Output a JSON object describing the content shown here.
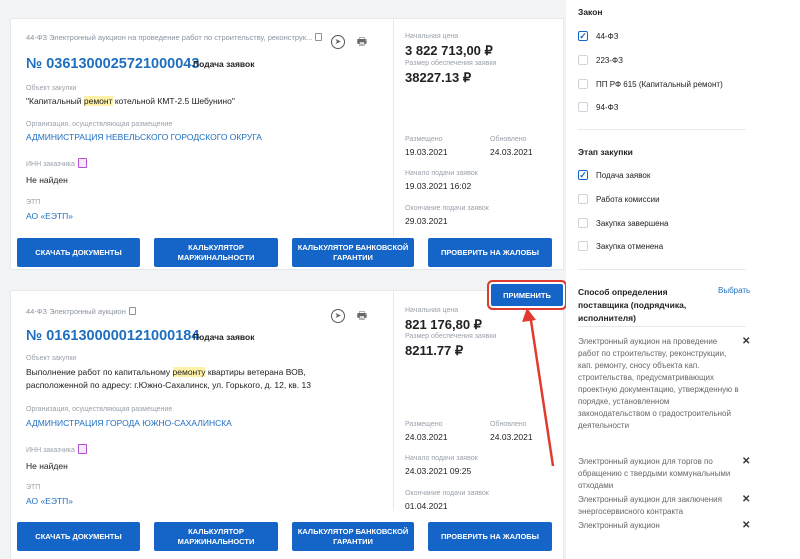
{
  "cards": [
    {
      "tag": "44-ФЗ Электронный аукцион на проведение работ по строительству, реконструк...",
      "number": "№ 0361300025721000043",
      "status": "Подача заявок",
      "object_label": "Объект закупки",
      "object_pre": "\"Капитальный ",
      "object_hl": "ремонт",
      "object_post": " котельной КМТ-2.5 Шебунино\"",
      "org_label": "Организация, осуществляющая размещение",
      "org": "АДМИНИСТРАЦИЯ НЕВЕЛЬСКОГО ГОРОДСКОГО ОКРУГА",
      "inn_label": "ИНН заказчика",
      "inn": "Не найден",
      "etp_label": "ЭТП",
      "etp": "АО «ЕЭТП»",
      "start_price_label": "Начальная цена",
      "start_price": "3 822 713,00 ₽",
      "security_label": "Размер обеспечения заявки",
      "security": "38227.13 ₽",
      "placed_label": "Размещено",
      "placed": "19.03.2021",
      "updated_label": "Обновлено",
      "updated": "24.03.2021",
      "start_label": "Начало подачи заявок",
      "start": "19.03.2021 16:02",
      "end_label": "Окончание подачи заявок",
      "end": "29.03.2021"
    },
    {
      "tag": "44-ФЗ Электронный аукцион",
      "number": "№ 0161300000121000184",
      "status": "Подача заявок",
      "object_label": "Объект закупки",
      "object_pre": "Выполнение работ по капитальному ",
      "object_hl": "ремонту",
      "object_post": " квартиры ветерана ВОВ, расположенной по адресу: г.Южно-Сахалинск, ул. Горького, д. 12, кв. 13",
      "org_label": "Организация, осуществляющая размещение",
      "org": "АДМИНИСТРАЦИЯ ГОРОДА ЮЖНО-САХАЛИНСКА",
      "inn_label": "ИНН заказчика",
      "inn": "Не найден",
      "etp_label": "ЭТП",
      "etp": "АО «ЕЭТП»",
      "start_price_label": "Начальная цена",
      "start_price": "821 176,80 ₽",
      "security_label": "Размер обеспечения заявки",
      "security": "8211.77 ₽",
      "placed_label": "Размещено",
      "placed": "24.03.2021",
      "updated_label": "Обновлено",
      "updated": "24.03.2021",
      "start_label": "Начало подачи заявок",
      "start": "24.03.2021 09:25",
      "end_label": "Окончание подачи заявок",
      "end": "01.04.2021"
    }
  ],
  "buttons": {
    "download": "СКАЧАТЬ ДОКУМЕНТЫ",
    "margin_calc_1": "КАЛЬКУЛЯТОР",
    "margin_calc_2": "МАРЖИНАЛЬНОСТИ",
    "bank_calc_1": "КАЛЬКУЛЯТОР БАНКОВСКОЙ",
    "bank_calc_2": "ГАРАНТИИ",
    "complaints": "ПРОВЕРИТЬ НА ЖАЛОБЫ",
    "apply": "ПРИМЕНИТЬ"
  },
  "icons": {
    "card_left": "compass-icon",
    "card_right": "printer-icon",
    "copy": "copy-icon",
    "inn": "document-icon",
    "close": "close-icon"
  },
  "sidebar": {
    "law_title": "Закон",
    "laws": [
      {
        "label": "44-ФЗ",
        "checked": true
      },
      {
        "label": "223-ФЗ",
        "checked": false
      },
      {
        "label": "ПП РФ 615 (Капитальный ремонт)",
        "checked": false
      },
      {
        "label": "94-ФЗ",
        "checked": false
      }
    ],
    "stage_title": "Этап закупки",
    "stages": [
      {
        "label": "Подача заявок",
        "checked": true
      },
      {
        "label": "Работа комиссии",
        "checked": false
      },
      {
        "label": "Закупка завершена",
        "checked": false
      },
      {
        "label": "Закупка отменена",
        "checked": false
      }
    ],
    "method_title_1": "Способ определения",
    "method_title_2": "поставщика (подрядчика,",
    "method_title_3": "исполнителя)",
    "choose": "Выбрать",
    "methods": [
      "Электронный аукцион на проведение работ по строительству, реконструкции, кап. ремонту, сносу объекта кап. строительства, предусматривающих проектную документацию, утвержденную в порядке, установленном законодательством о градостроительной деятельности",
      "Электронный аукцион для торгов по обращению с твердыми коммунальными отходами",
      "Электронный аукцион для заключения энергосервисного контракта",
      "Электронный аукцион"
    ],
    "close_glyph": "✕",
    "check_glyph": "✓"
  },
  "colors": {
    "primary": "#1565c8",
    "link": "#1f6fc0",
    "highlight": "#fff2a8",
    "annotation": "#e03b2f"
  }
}
